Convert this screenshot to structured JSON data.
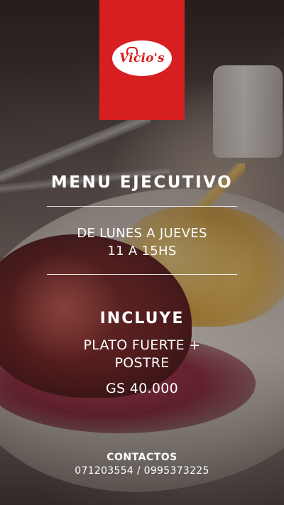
{
  "logo": {
    "text": "Vicio's"
  },
  "menu": {
    "title": "MENU EJECUTIVO",
    "days": "DE LUNES A JUEVES",
    "hours": "11 A 15HS"
  },
  "includes": {
    "title": "INCLUYE",
    "dish_line1": "PLATO FUERTE +",
    "dish_line2": "POSTRE",
    "price": "GS 40.000"
  },
  "contacts": {
    "title": "CONTACTOS",
    "phones": "071203554 / 0995373225"
  },
  "colors": {
    "brand_red": "#d81f1f",
    "text": "#ffffff"
  }
}
